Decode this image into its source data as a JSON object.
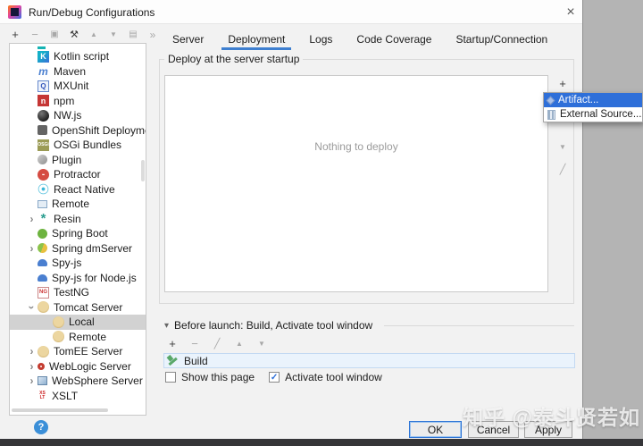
{
  "window": {
    "title": "Run/Debug Configurations",
    "close_glyph": "×"
  },
  "left_toolbar": {
    "icons": [
      {
        "name": "add-icon",
        "glyph": "+",
        "enabled": true,
        "fs": 13
      },
      {
        "name": "remove-icon",
        "glyph": "−",
        "enabled": false,
        "fs": 13
      },
      {
        "name": "copy-icon",
        "glyph": "▣",
        "enabled": false,
        "fs": 10
      },
      {
        "name": "edit-defaults-wrench-icon",
        "glyph": "⚒",
        "enabled": true,
        "fs": 11
      },
      {
        "name": "move-up-icon",
        "glyph": "▲",
        "enabled": false,
        "fs": 8
      },
      {
        "name": "move-down-icon",
        "glyph": "▼",
        "enabled": false,
        "fs": 8
      },
      {
        "name": "create-folder-icon",
        "glyph": "▤",
        "enabled": false,
        "fs": 10
      },
      {
        "name": "show-more-icon",
        "glyph": "»",
        "enabled": false,
        "fs": 12
      }
    ]
  },
  "sidebar": {
    "chevron_glyph": "›",
    "items": [
      {
        "label": "",
        "partial": true
      },
      {
        "label": "Kotlin script",
        "chevron": "none",
        "indent": 0,
        "selected": false,
        "icon": {
          "name": "kotlin-icon",
          "glyph": "K",
          "bg": "linear-gradient(135deg,#14b0c8 30%,#3a6fd8)",
          "fg": "#fff",
          "fs": 9
        }
      },
      {
        "label": "Maven",
        "chevron": "none",
        "indent": 0,
        "selected": false,
        "icon": {
          "name": "maven-icon",
          "glyph": "m",
          "fg": "#4a7fd0",
          "fs": 12,
          "it": true
        }
      },
      {
        "label": "MXUnit",
        "chevron": "none",
        "indent": 0,
        "selected": false,
        "icon": {
          "name": "mxunit-icon",
          "glyph": "Q",
          "bg": "#eef3fb",
          "fg": "#3355bb",
          "fs": 8,
          "bd": "1px solid #6688cc"
        }
      },
      {
        "label": "npm",
        "chevron": "none",
        "indent": 0,
        "selected": false,
        "icon": {
          "name": "npm-icon",
          "glyph": "n",
          "bg": "#c53635",
          "fg": "#fff",
          "fs": 9
        }
      },
      {
        "label": "NW.js",
        "chevron": "none",
        "indent": 0,
        "selected": false,
        "icon": {
          "name": "nwjs-icon",
          "glyph": "",
          "bg": "radial-gradient(circle at 35% 30%,#777 0%,#222 70%)",
          "br": "50%"
        }
      },
      {
        "label": "OpenShift Deployment",
        "chevron": "none",
        "indent": 0,
        "selected": false,
        "icon": {
          "name": "openshift-icon",
          "glyph": "",
          "bg": "#646464",
          "br": "2px",
          "w": 11,
          "h": 11
        }
      },
      {
        "label": "OSGi Bundles",
        "chevron": "none",
        "indent": 0,
        "selected": false,
        "icon": {
          "name": "osgi-icon",
          "glyph": "OSGi",
          "bg": "#9b9b55",
          "fg": "#fff",
          "fs": 5
        }
      },
      {
        "label": "Plugin",
        "chevron": "none",
        "indent": 0,
        "selected": false,
        "icon": {
          "name": "plugin-icon",
          "glyph": "",
          "bg": "linear-gradient(135deg,#d0d0d0,#909090)",
          "br": "50%",
          "w": 11,
          "h": 11
        }
      },
      {
        "label": "Protractor",
        "chevron": "none",
        "indent": 0,
        "selected": false,
        "icon": {
          "name": "protractor-icon",
          "glyph": "-",
          "bg": "#d54b42",
          "fg": "#fff",
          "fs": 10,
          "br": "50%"
        }
      },
      {
        "label": "React Native",
        "chevron": "none",
        "indent": 0,
        "selected": false,
        "icon": {
          "name": "react-native-icon",
          "glyph": "",
          "bg": "radial-gradient(circle,#3ab7d8 18%,rgba(0,0,0,0) 24%,rgba(0,0,0,0) 52%,#3ab7d8 58%,rgba(0,0,0,0) 66%)",
          "br": "50%"
        }
      },
      {
        "label": "Remote",
        "chevron": "none",
        "indent": 0,
        "selected": false,
        "icon": {
          "name": "remote-icon",
          "glyph": "",
          "bg": "#e4edf5",
          "bd": "1px solid #88a8c8",
          "w": 11,
          "h": 9
        }
      },
      {
        "label": "Resin",
        "chevron": "collapsed",
        "indent": 0,
        "selected": false,
        "icon": {
          "name": "resin-icon",
          "glyph": "*",
          "fg": "#2a9d8f",
          "fs": 15
        }
      },
      {
        "label": "Spring Boot",
        "chevron": "none",
        "indent": 0,
        "selected": false,
        "icon": {
          "name": "spring-boot-icon",
          "glyph": "",
          "bg": "#6db33f",
          "br": "50%",
          "w": 11,
          "h": 11
        }
      },
      {
        "label": "Spring dmServer",
        "chevron": "collapsed",
        "indent": 0,
        "selected": false,
        "icon": {
          "name": "spring-dmserver-icon",
          "glyph": "",
          "bg": "linear-gradient(110deg,#8bc34a 50%,#e8c040 50%)",
          "br": "50%",
          "w": 11,
          "h": 11
        }
      },
      {
        "label": "Spy-js",
        "chevron": "none",
        "indent": 0,
        "selected": false,
        "icon": {
          "name": "spy-js-icon",
          "glyph": "",
          "bg": "#4a7fd0",
          "br": "6px 6px 2px 2px",
          "w": 11,
          "h": 8
        }
      },
      {
        "label": "Spy-js for Node.js",
        "chevron": "none",
        "indent": 0,
        "selected": false,
        "icon": {
          "name": "spy-js-node-icon",
          "glyph": "",
          "bg": "#4a7fd0",
          "br": "6px 6px 2px 2px",
          "w": 11,
          "h": 8
        }
      },
      {
        "label": "TestNG",
        "chevron": "none",
        "indent": 0,
        "selected": false,
        "icon": {
          "name": "testng-icon",
          "glyph": "NG",
          "bg": "#fff",
          "fg": "#cc3333",
          "fs": 6,
          "bd": "1px solid #cc8888"
        }
      },
      {
        "label": "Tomcat Server",
        "chevron": "expanded",
        "indent": 0,
        "selected": false,
        "icon": {
          "name": "tomcat-icon",
          "glyph": "",
          "bg": "radial-gradient(circle at 50% 45%,#ecd6a0 55%,#b08838)",
          "br": "50%"
        }
      },
      {
        "label": "Local",
        "chevron": "none",
        "indent": 1,
        "selected": true,
        "icon": {
          "name": "tomcat-icon",
          "glyph": "",
          "bg": "radial-gradient(circle at 50% 45%,#ecd6a0 55%,#b08838)",
          "br": "50%"
        }
      },
      {
        "label": "Remote",
        "chevron": "none",
        "indent": 1,
        "selected": false,
        "icon": {
          "name": "tomcat-icon",
          "glyph": "",
          "bg": "radial-gradient(circle at 50% 45%,#ecd6a0 55%,#b08838)",
          "br": "50%"
        }
      },
      {
        "label": "TomEE Server",
        "chevron": "collapsed",
        "indent": 0,
        "selected": false,
        "icon": {
          "name": "tomee-icon",
          "glyph": "",
          "bg": "radial-gradient(circle at 50% 45%,#ecd6a0 55%,#b08838)",
          "br": "50%"
        }
      },
      {
        "label": "WebLogic Server",
        "chevron": "collapsed",
        "indent": 0,
        "selected": false,
        "icon": {
          "name": "weblogic-icon",
          "glyph": "",
          "bg": "#fff",
          "bd": "3px solid #c43c30",
          "br": "4px",
          "w": 8,
          "h": 8
        }
      },
      {
        "label": "WebSphere Server",
        "chevron": "collapsed",
        "indent": 0,
        "selected": false,
        "icon": {
          "name": "websphere-icon",
          "glyph": "",
          "bg": "linear-gradient(135deg,#dce8f4,#8fb0d0)",
          "bd": "1px solid #6688aa",
          "w": 11,
          "h": 10
        }
      },
      {
        "label": "XSLT",
        "chevron": "none",
        "indent": 0,
        "selected": false,
        "icon": {
          "name": "xslt-icon",
          "glyph": "XS LT",
          "fg": "#cc2222",
          "fs": 5,
          "wrap": true,
          "w": 11,
          "h": 11
        }
      }
    ]
  },
  "tabs": {
    "items": [
      {
        "label": "Server",
        "selected": false
      },
      {
        "label": "Deployment",
        "selected": true
      },
      {
        "label": "Logs",
        "selected": false
      },
      {
        "label": "Code Coverage",
        "selected": false
      },
      {
        "label": "Startup/Connection",
        "selected": false
      }
    ]
  },
  "deploy_group": {
    "legend": "Deploy at the server startup",
    "empty_text": "Nothing to deploy",
    "toolbar": [
      {
        "name": "add-icon",
        "glyph": "+",
        "enabled": true,
        "fs": 13
      },
      {
        "name": "move-down-icon",
        "glyph": "▼",
        "enabled": false,
        "fs": 8
      },
      {
        "name": "edit-icon",
        "glyph": "╱",
        "enabled": false,
        "fs": 11
      }
    ]
  },
  "popup": {
    "items": [
      {
        "label": "Artifact...",
        "selected": true,
        "icon": "artifact-icon"
      },
      {
        "label": "External Source...",
        "selected": false,
        "icon": "external-source-icon"
      }
    ]
  },
  "before_launch": {
    "collapse_glyph": "▾",
    "label": "Before launch: Build, Activate tool window",
    "toolbar": [
      {
        "name": "add-icon",
        "glyph": "+",
        "enabled": true,
        "fs": 13
      },
      {
        "name": "remove-icon",
        "glyph": "−",
        "enabled": false,
        "fs": 13
      },
      {
        "name": "edit-icon",
        "glyph": "╱",
        "enabled": false,
        "fs": 11
      },
      {
        "name": "move-up-icon",
        "glyph": "▲",
        "enabled": false,
        "fs": 8
      },
      {
        "name": "move-down-icon",
        "glyph": "▼",
        "enabled": false,
        "fs": 8
      }
    ],
    "task": {
      "label": "Build"
    },
    "checkboxes": [
      {
        "label": "Show this page",
        "checked": false
      },
      {
        "label": "Activate tool window",
        "checked": true
      }
    ],
    "check_glyph": "✓"
  },
  "footer": {
    "help_glyph": "?",
    "buttons": [
      {
        "label": "OK",
        "default": true
      },
      {
        "label": "Cancel",
        "default": false
      },
      {
        "label": "Apply",
        "default": false
      }
    ]
  },
  "watermark": {
    "text": "知乎 @泰斗贤若如"
  },
  "colors": {
    "accent_blue": "#3e7fd0",
    "popup_selection": "#2e6fd9",
    "build_row_bg": "#eaf3fc",
    "hammer_green": "#59a869",
    "desktop_gray": "#b4b4b4",
    "selection_gray": "#d2d2d2"
  }
}
